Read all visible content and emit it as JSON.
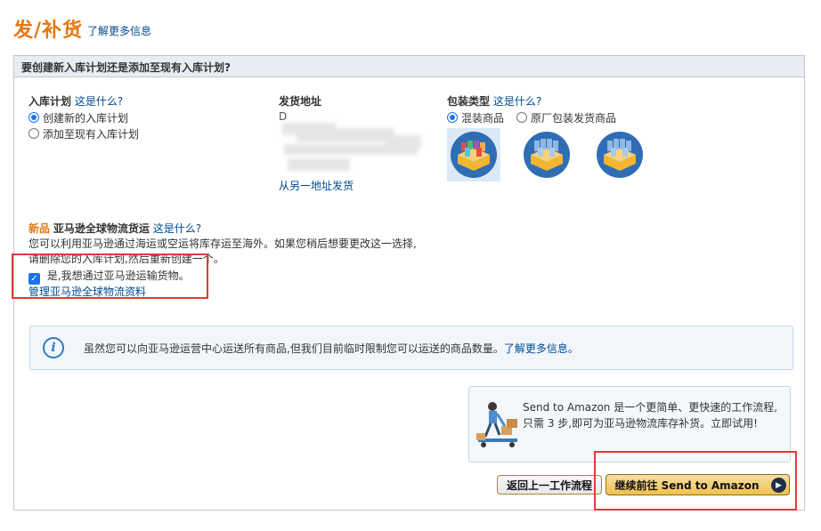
{
  "header": {
    "title": "发/补货",
    "learn_more": "了解更多信息"
  },
  "panel": {
    "question": "要创建新入库计划还是添加至现有入库计划?"
  },
  "inbound_plan": {
    "label": "入库计划",
    "what_is_this": "这是什么?",
    "options": [
      "创建新的入库计划",
      "添加至现有入库计划"
    ],
    "selected_index": 0
  },
  "ship_from": {
    "label": "发货地址",
    "partial_text": "D",
    "change_link": "从另一地址发货"
  },
  "packing": {
    "label": "包装类型",
    "what_is_this": "这是什么?",
    "options": [
      "混装商品",
      "原厂包装发货商品"
    ],
    "selected_index": 0
  },
  "global_logistics": {
    "new_tag": "新品",
    "title": "亚马逊全球物流货运",
    "what_is_this": "这是什么?",
    "description_line1": "您可以利用亚马逊通过海运或空运将库存运至海外。如果您稍后想要更改这一选择,",
    "description_line2": "请删除您的入库计划,然后重新创建一个。",
    "checkbox_label": "是,我想通过亚马逊运输货物。",
    "checkbox_checked": true,
    "manage_link": "管理亚马逊全球物流资料"
  },
  "info_notice": {
    "icon": "info-icon",
    "text": "虽然您可以向亚马逊运营中心运送所有商品,但我们目前临时限制您可以运送的商品数量。",
    "link": "了解更多信息。"
  },
  "send_to_amazon": {
    "description": "Send to Amazon 是一个更简单、更快速的工作流程,只需 3 步,即可为亚马逊物流库存补货。立即试用!"
  },
  "buttons": {
    "back": "返回上一工作流程",
    "continue": "继续前往 Send to Amazon"
  },
  "colors": {
    "title_orange": "#e47911",
    "link_blue": "#004b91",
    "highlight_red": "#e03a3a",
    "button_gold": "#f0c14b"
  }
}
